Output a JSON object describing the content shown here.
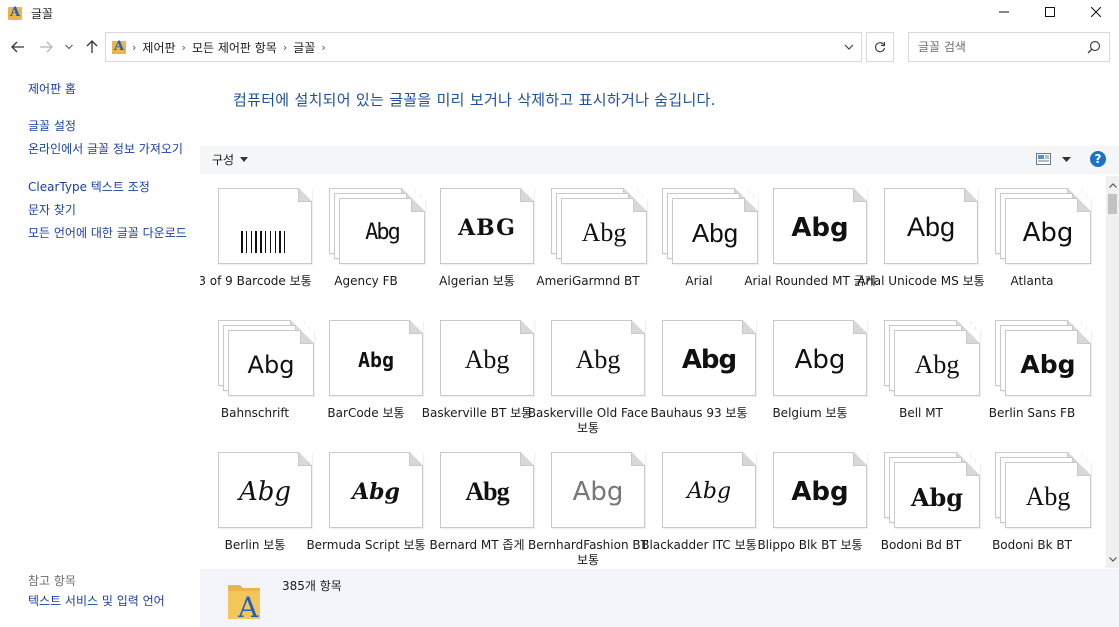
{
  "window": {
    "title": "글꼴"
  },
  "address": {
    "crumbs": [
      "제어판",
      "모든 제어판 항목",
      "글꼴"
    ]
  },
  "search": {
    "placeholder": "글꼴 검색"
  },
  "left_panel": {
    "home": "제어판 홈",
    "links": [
      "글꼴 설정",
      "온라인에서 글꼴 정보 가져오기",
      "ClearType 텍스트 조정",
      "문자 찾기",
      "모든 언어에 대한 글꼴 다운로드"
    ],
    "see_also_heading": "참고 항목",
    "see_also": [
      "텍스트 서비스 및 입력 언어"
    ]
  },
  "main": {
    "headline": "컴퓨터에 설치되어 있는 글꼴을 미리 보거나 삭제하고 표시하거나 숨깁니다.",
    "organize_label": "구성",
    "help_label": "?"
  },
  "fonts": [
    {
      "name": "3 of 9 Barcode 보통",
      "sample": "barcode",
      "stack": false
    },
    {
      "name": "Agency FB",
      "sample": "Abg",
      "stack": true
    },
    {
      "name": "Algerian 보통",
      "sample": "ABG",
      "stack": false
    },
    {
      "name": "AmeriGarmnd BT",
      "sample": "Abg",
      "stack": true
    },
    {
      "name": "Arial",
      "sample": "Abg",
      "stack": true
    },
    {
      "name": "Arial Rounded MT 굵게",
      "sample": "Abg",
      "stack": false
    },
    {
      "name": "Arial Unicode MS 보통",
      "sample": "Abg",
      "stack": false
    },
    {
      "name": "Atlanta",
      "sample": "Abg",
      "stack": true
    },
    {
      "name": "Bahnschrift",
      "sample": "Abg",
      "stack": true
    },
    {
      "name": "BarCode 보통",
      "sample": "Abg",
      "stack": false
    },
    {
      "name": "Baskerville BT 보통",
      "sample": "Abg",
      "stack": false
    },
    {
      "name": "Baskerville Old Face 보통",
      "sample": "Abg",
      "stack": false
    },
    {
      "name": "Bauhaus 93 보통",
      "sample": "Abg",
      "stack": false
    },
    {
      "name": "Belgium 보통",
      "sample": "Abg",
      "stack": false
    },
    {
      "name": "Bell MT",
      "sample": "Abg",
      "stack": true
    },
    {
      "name": "Berlin Sans FB",
      "sample": "Abg",
      "stack": true
    },
    {
      "name": "Berlin 보통",
      "sample": "Abg",
      "stack": false
    },
    {
      "name": "Bermuda Script 보통",
      "sample": "Abg",
      "stack": false
    },
    {
      "name": "Bernard MT 좁게",
      "sample": "Abg",
      "stack": false
    },
    {
      "name": "BernhardFashion BT 보통",
      "sample": "Abg",
      "stack": false
    },
    {
      "name": "Blackadder ITC 보통",
      "sample": "Abg",
      "stack": false
    },
    {
      "name": "Blippo Blk BT 보통",
      "sample": "Abg",
      "stack": false
    },
    {
      "name": "Bodoni Bd BT",
      "sample": "Abg",
      "stack": true
    },
    {
      "name": "Bodoni Bk BT",
      "sample": "Abg",
      "stack": true
    }
  ],
  "details": {
    "count": "385개 항목"
  }
}
